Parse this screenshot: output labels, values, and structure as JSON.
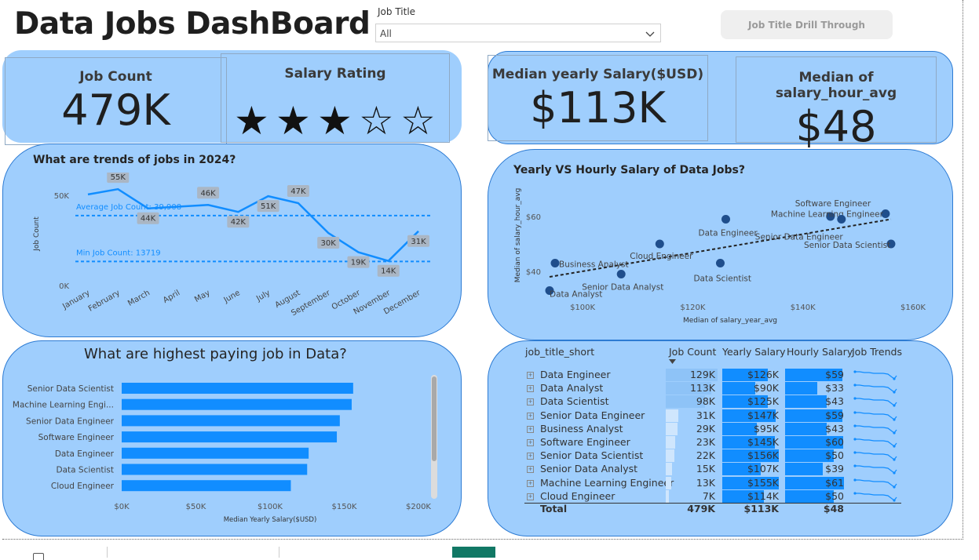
{
  "dashboard_title": "Data Jobs DashBoard",
  "slicer": {
    "label": "Job Title",
    "value": "All"
  },
  "drill_button": "Job Title Drill Through",
  "kpis": {
    "job_count": {
      "title": "Job Count",
      "value": "479K"
    },
    "salary_rating": {
      "title": "Salary Rating",
      "stars_filled": 3,
      "stars_total": 5
    },
    "median_yearly": {
      "title": "Median yearly Salary($USD)",
      "value": "$113K"
    },
    "median_hourly": {
      "title": "Median of salary_hour_avg",
      "value": "$48"
    }
  },
  "colors": {
    "panel": "#9fcefd",
    "accent": "#118dff",
    "dark_point": "#1f4e8c"
  },
  "chart_data": [
    {
      "type": "line",
      "title": "What are trends of jobs in 2024?",
      "ylabel": "Job Count",
      "categories": [
        "January",
        "February",
        "March",
        "April",
        "May",
        "June",
        "July",
        "August",
        "September",
        "October",
        "November",
        "December"
      ],
      "values": [
        52000,
        55000,
        44000,
        45000,
        46000,
        42000,
        51000,
        47000,
        30000,
        19000,
        14000,
        31000
      ],
      "data_labels": [
        "",
        "55K",
        "44K",
        "",
        "46K",
        "42K",
        "51K",
        "47K",
        "30K",
        "19K",
        "14K",
        "31K"
      ],
      "yticks": [
        "0K",
        "50K"
      ],
      "ylim": [
        0,
        60000
      ],
      "reference_lines": [
        {
          "label": "Average Job Count: 39,908",
          "value": 39908
        },
        {
          "label": "Min Job Count: 13719",
          "value": 13719
        }
      ]
    },
    {
      "type": "scatter",
      "title": "Yearly VS Hourly Salary of Data Jobs?",
      "xlabel": "Median of salary_year_avg",
      "ylabel": "Median of salary_hour_avg",
      "xticks": [
        "$100K",
        "$120K",
        "$140K",
        "$160K"
      ],
      "yticks": [
        "$40",
        "$60"
      ],
      "xlim": [
        94000,
        162000
      ],
      "ylim": [
        32,
        65
      ],
      "points": [
        {
          "label": "Data Analyst",
          "x": 90000,
          "y": 33
        },
        {
          "label": "Business Analyst",
          "x": 95000,
          "y": 43
        },
        {
          "label": "Senior Data Analyst",
          "x": 107000,
          "y": 39
        },
        {
          "label": "Cloud Engineer",
          "x": 114000,
          "y": 50
        },
        {
          "label": "Data Scientist",
          "x": 125000,
          "y": 43
        },
        {
          "label": "Data Engineer",
          "x": 126000,
          "y": 59
        },
        {
          "label": "Software Engineer",
          "x": 145000,
          "y": 60
        },
        {
          "label": "Machine Learning Engineer",
          "x": 155000,
          "y": 61
        },
        {
          "label": "Senior Data Engineer",
          "x": 147000,
          "y": 59
        },
        {
          "label": "Senior Data Scientist",
          "x": 156000,
          "y": 50
        }
      ],
      "trendline": {
        "x1": 94000,
        "y1": 38,
        "x2": 156000,
        "y2": 59
      }
    },
    {
      "type": "bar",
      "title": "What are highest paying job in Data?",
      "xlabel": "Median Yearly Salary($USD)",
      "categories": [
        "Senior Data Scientist",
        "Machine Learning Engi...",
        "Senior Data Engineer",
        "Software Engineer",
        "Data Engineer",
        "Data Scientist",
        "Cloud Engineer"
      ],
      "values": [
        156000,
        155000,
        147000,
        145000,
        126000,
        125000,
        114000
      ],
      "xticks": [
        "$0K",
        "$50K",
        "$100K",
        "$150K",
        "$200K"
      ],
      "xlim": [
        0,
        200000
      ]
    },
    {
      "type": "table",
      "columns": [
        "job_title_short",
        "Job Count",
        "Yearly Salary",
        "Hourly Salary",
        "Job Trends"
      ],
      "rows": [
        {
          "title": "Data Engineer",
          "count": "129K",
          "count_v": 129,
          "yearly": "$126K",
          "yearly_v": 126,
          "hourly": "$59",
          "hourly_v": 59
        },
        {
          "title": "Data Analyst",
          "count": "113K",
          "count_v": 113,
          "yearly": "$90K",
          "yearly_v": 90,
          "hourly": "$33",
          "hourly_v": 33
        },
        {
          "title": "Data Scientist",
          "count": "98K",
          "count_v": 98,
          "yearly": "$125K",
          "yearly_v": 125,
          "hourly": "$43",
          "hourly_v": 43
        },
        {
          "title": "Senior Data Engineer",
          "count": "31K",
          "count_v": 31,
          "yearly": "$147K",
          "yearly_v": 147,
          "hourly": "$59",
          "hourly_v": 59
        },
        {
          "title": "Business Analyst",
          "count": "29K",
          "count_v": 29,
          "yearly": "$95K",
          "yearly_v": 95,
          "hourly": "$43",
          "hourly_v": 43
        },
        {
          "title": "Software Engineer",
          "count": "23K",
          "count_v": 23,
          "yearly": "$145K",
          "yearly_v": 145,
          "hourly": "$60",
          "hourly_v": 60
        },
        {
          "title": "Senior Data Scientist",
          "count": "22K",
          "count_v": 22,
          "yearly": "$156K",
          "yearly_v": 156,
          "hourly": "$50",
          "hourly_v": 50
        },
        {
          "title": "Senior Data Analyst",
          "count": "15K",
          "count_v": 15,
          "yearly": "$107K",
          "yearly_v": 107,
          "hourly": "$39",
          "hourly_v": 39
        },
        {
          "title": "Machine Learning Engineer",
          "count": "13K",
          "count_v": 13,
          "yearly": "$155K",
          "yearly_v": 155,
          "hourly": "$61",
          "hourly_v": 61
        },
        {
          "title": "Cloud Engineer",
          "count": "7K",
          "count_v": 7,
          "yearly": "$114K",
          "yearly_v": 114,
          "hourly": "$50",
          "hourly_v": 50
        }
      ],
      "total": {
        "title": "Total",
        "count": "479K",
        "yearly": "$113K",
        "hourly": "$48"
      }
    }
  ]
}
